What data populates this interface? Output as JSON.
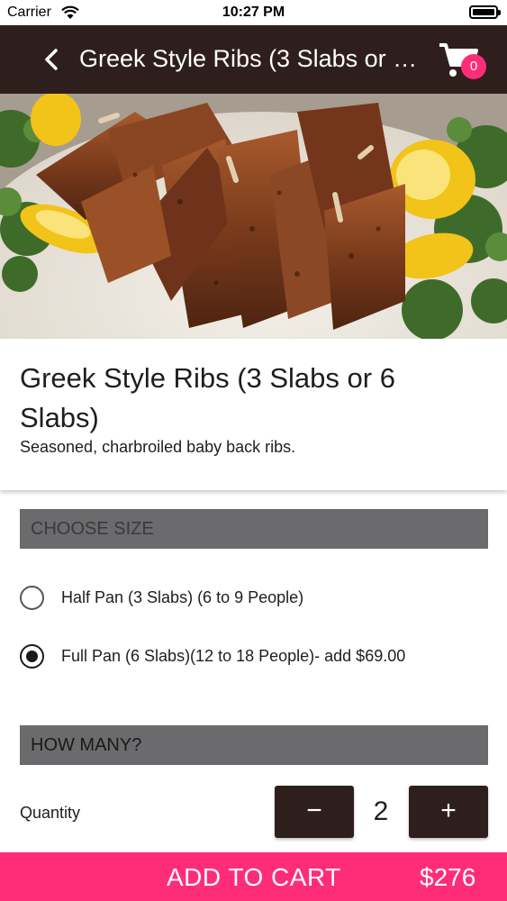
{
  "status_bar": {
    "carrier": "Carrier",
    "time": "10:27 PM"
  },
  "nav": {
    "title": "Greek Style Ribs (3 Slabs or 6 Slabs)",
    "cart_count": "0",
    "background_color": "#2e1f1d"
  },
  "product": {
    "title": "Greek Style Ribs (3 Slabs or 6 Slabs)",
    "description": "Seasoned, charbroiled baby back ribs."
  },
  "size_section": {
    "header": "CHOOSE SIZE",
    "options": [
      {
        "label": "Half Pan (3 Slabs) (6 to 9 People)",
        "selected": false
      },
      {
        "label": "Full Pan (6 Slabs)(12 to 18 People)- add $69.00",
        "selected": true
      }
    ]
  },
  "quantity_section": {
    "header": "HOW MANY?",
    "label": "Quantity",
    "value": "2",
    "decrement_symbol": "−",
    "increment_symbol": "+"
  },
  "add_to_cart": {
    "label": "ADD TO CART",
    "price": "$276",
    "color": "#ff2d78"
  }
}
